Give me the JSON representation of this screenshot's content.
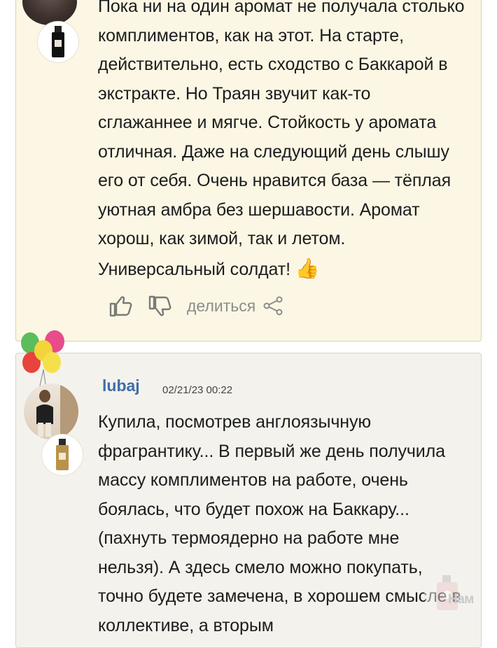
{
  "review1": {
    "text": "Пока ни на один аромат не получала столько комплиментов, как на этот. На старте, действительно, есть сходство с Баккарой в экстракте. Но Траян звучит как-то сглажаннее и мягче. Стойкость у аромата отличная. Даже на следующий день слышу его от себя. Очень нравится база — тёплая уютная амбра без шершавости. Аромат хорош, как зимой, так и летом. Универсальный солдат!",
    "emoji": "👍",
    "share_label": "делиться",
    "icons": [
      "thumbs-up-icon",
      "thumbs-down-icon",
      "share-icon"
    ]
  },
  "review2": {
    "username": "lubaj",
    "date": "02/21/23 00:22",
    "text": "Купила, посмотрев англоязычную фрагрантику... В первый же день получила массу комплиментов на работе, очень боялась, что будет похож на Баккару...(пахнуть термоядерно на работе мне нельзя). А здесь смело можно покупать, точно будете замечена, в хорошем смысле в коллективе, а вторым"
  },
  "watermark": {
    "text": "Нам"
  },
  "colors": {
    "card1_bg": "#fbf7e4",
    "card2_bg": "#f4f2ec",
    "username": "#3f6ea8",
    "muted": "#8c8c8c"
  }
}
